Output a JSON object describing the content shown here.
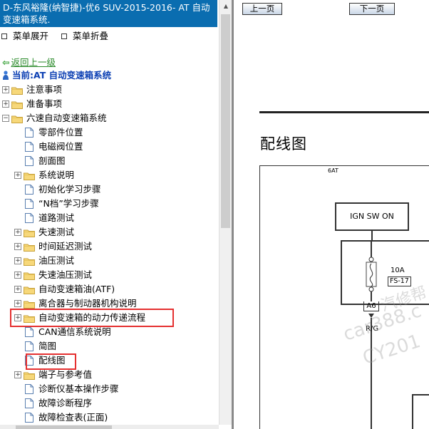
{
  "window": {
    "title": "D-东风裕隆(纳智捷)-优6 SUV-2015-2016- AT 自动变速箱系统."
  },
  "menu": {
    "expand_label": "菜单展开",
    "collapse_label": "菜单折叠"
  },
  "nav": {
    "back_label": "返回上一级",
    "current_label": "当前:AT 自动变速箱系统"
  },
  "tree": [
    {
      "label": "注意事项",
      "type": "folder",
      "level": 0,
      "expander": "+"
    },
    {
      "label": "准备事项",
      "type": "folder",
      "level": 0,
      "expander": "+"
    },
    {
      "label": "六速自动变速箱系统",
      "type": "folder",
      "level": 0,
      "expander": "-"
    },
    {
      "label": "零部件位置",
      "type": "page",
      "level": 1
    },
    {
      "label": "电磁阀位置",
      "type": "page",
      "level": 1
    },
    {
      "label": "剖面图",
      "type": "page",
      "level": 1
    },
    {
      "label": "系统说明",
      "type": "folder",
      "level": 1,
      "expander": "+"
    },
    {
      "label": "初始化学习步骤",
      "type": "page",
      "level": 1
    },
    {
      "label": "“N档”学习步骤",
      "type": "page",
      "level": 1
    },
    {
      "label": "道路测试",
      "type": "page",
      "level": 1
    },
    {
      "label": "失速测试",
      "type": "folder",
      "level": 1,
      "expander": "+"
    },
    {
      "label": "时间延迟测试",
      "type": "folder",
      "level": 1,
      "expander": "+"
    },
    {
      "label": "油压测试",
      "type": "folder",
      "level": 1,
      "expander": "+"
    },
    {
      "label": "失速油压测试",
      "type": "folder",
      "level": 1,
      "expander": "+"
    },
    {
      "label": "自动变速箱油(ATF)",
      "type": "folder",
      "level": 1,
      "expander": "+"
    },
    {
      "label": "离合器与制动器机构说明",
      "type": "folder",
      "level": 1,
      "expander": "+"
    },
    {
      "label": "自动变速箱的动力传递流程",
      "type": "folder",
      "level": 1,
      "expander": "+"
    },
    {
      "label": "CAN通信系统说明",
      "type": "page",
      "level": 1
    },
    {
      "label": "简图",
      "type": "page",
      "level": 1
    },
    {
      "label": "配线图",
      "type": "page",
      "level": 1
    },
    {
      "label": "端子与参考值",
      "type": "folder",
      "level": 1,
      "expander": "+"
    },
    {
      "label": "诊断仪基本操作步骤",
      "type": "page",
      "level": 1
    },
    {
      "label": "故障诊断程序",
      "type": "page",
      "level": 1
    },
    {
      "label": "故障检查表(正面)",
      "type": "page",
      "level": 1
    }
  ],
  "toolbar": {
    "prev_label": "上一页",
    "next_label": "下一页"
  },
  "document": {
    "title": "配线图",
    "frame_label": "6AT",
    "ign_label": "IGN SW ON",
    "fuse_amp": "10A",
    "fuse_id": "FS-17",
    "connector": "A6",
    "wire_color": "R/G"
  },
  "watermark": {
    "line1": "汽修帮",
    "line2": "car388.c",
    "line3": "CY201"
  },
  "colors": {
    "title_bar": "#0a6db0",
    "current_text": "#0b3fb3",
    "back_link": "#2a8a2a",
    "highlight": "#e53030"
  }
}
